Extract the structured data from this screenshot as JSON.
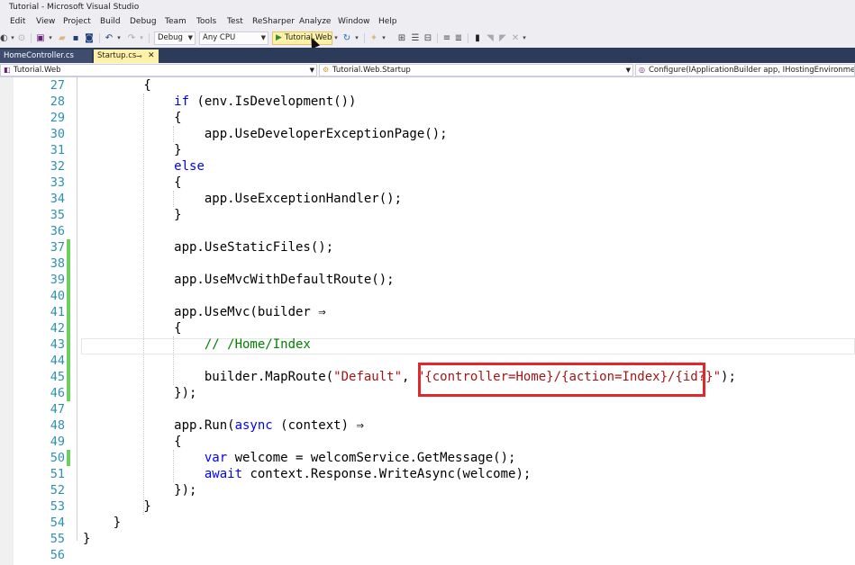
{
  "window": {
    "title": "Tutorial - Microsoft Visual Studio"
  },
  "menu": [
    "Edit",
    "View",
    "Project",
    "Build",
    "Debug",
    "Team",
    "Tools",
    "Test",
    "ReSharper",
    "Analyze",
    "Window",
    "Help"
  ],
  "toolbar": {
    "configuration": "Debug",
    "platform": "Any CPU",
    "run_target": "Tutorial.Web"
  },
  "tabs": [
    {
      "label": "HomeController.cs",
      "active": false
    },
    {
      "label": "Startup.cs",
      "active": true
    }
  ],
  "navbar": {
    "project": "Tutorial.Web",
    "type": "Tutorial.Web.Startup",
    "member": "Configure(IApplicationBuilder app, IHostingEnvironment env,"
  },
  "editor": {
    "lines": [
      {
        "num": "27",
        "changed": false,
        "parts": [
          {
            "t": "        {",
            "c": "p"
          }
        ]
      },
      {
        "num": "28",
        "changed": false,
        "parts": [
          {
            "t": "            ",
            "c": "p"
          },
          {
            "t": "if",
            "c": "kw"
          },
          {
            "t": " (env.IsDevelopment())",
            "c": "p"
          }
        ]
      },
      {
        "num": "29",
        "changed": false,
        "parts": [
          {
            "t": "            {",
            "c": "p"
          }
        ]
      },
      {
        "num": "30",
        "changed": false,
        "parts": [
          {
            "t": "                app.UseDeveloperExceptionPage();",
            "c": "p"
          }
        ]
      },
      {
        "num": "31",
        "changed": false,
        "parts": [
          {
            "t": "            }",
            "c": "p"
          }
        ]
      },
      {
        "num": "32",
        "changed": false,
        "parts": [
          {
            "t": "            ",
            "c": "p"
          },
          {
            "t": "else",
            "c": "kw"
          }
        ]
      },
      {
        "num": "33",
        "changed": false,
        "parts": [
          {
            "t": "            {",
            "c": "p"
          }
        ]
      },
      {
        "num": "34",
        "changed": false,
        "parts": [
          {
            "t": "                app.UseExceptionHandler();",
            "c": "p"
          }
        ]
      },
      {
        "num": "35",
        "changed": false,
        "parts": [
          {
            "t": "            }",
            "c": "p"
          }
        ]
      },
      {
        "num": "36",
        "changed": false,
        "parts": [
          {
            "t": "",
            "c": "p"
          }
        ]
      },
      {
        "num": "37",
        "changed": true,
        "parts": [
          {
            "t": "            app.UseStaticFiles();",
            "c": "p"
          }
        ]
      },
      {
        "num": "38",
        "changed": true,
        "parts": [
          {
            "t": "",
            "c": "p"
          }
        ]
      },
      {
        "num": "39",
        "changed": true,
        "parts": [
          {
            "t": "            app.UseMvcWithDefaultRoute();",
            "c": "p"
          }
        ]
      },
      {
        "num": "40",
        "changed": true,
        "parts": [
          {
            "t": "",
            "c": "p"
          }
        ]
      },
      {
        "num": "41",
        "changed": true,
        "parts": [
          {
            "t": "            app.UseMvc(builder ⇒",
            "c": "p"
          }
        ]
      },
      {
        "num": "42",
        "changed": true,
        "parts": [
          {
            "t": "            {",
            "c": "p"
          }
        ]
      },
      {
        "num": "43",
        "changed": true,
        "parts": [
          {
            "t": "                ",
            "c": "p"
          },
          {
            "t": "// /Home/Index",
            "c": "cmt"
          }
        ]
      },
      {
        "num": "44",
        "changed": true,
        "parts": [
          {
            "t": "",
            "c": "p"
          }
        ]
      },
      {
        "num": "45",
        "changed": true,
        "parts": [
          {
            "t": "                builder.MapRoute(",
            "c": "p"
          },
          {
            "t": "\"Default\"",
            "c": "str"
          },
          {
            "t": ", ",
            "c": "p"
          },
          {
            "t": "\"{controller=Home}/{action=Index}/{id?}\"",
            "c": "str"
          },
          {
            "t": ");",
            "c": "p"
          }
        ]
      },
      {
        "num": "46",
        "changed": true,
        "parts": [
          {
            "t": "            });",
            "c": "p"
          }
        ]
      },
      {
        "num": "47",
        "changed": false,
        "parts": [
          {
            "t": "",
            "c": "p"
          }
        ]
      },
      {
        "num": "48",
        "changed": false,
        "parts": [
          {
            "t": "            app.Run(",
            "c": "p"
          },
          {
            "t": "async",
            "c": "kw"
          },
          {
            "t": " (context) ⇒",
            "c": "p"
          }
        ]
      },
      {
        "num": "49",
        "changed": false,
        "parts": [
          {
            "t": "            {",
            "c": "p"
          }
        ]
      },
      {
        "num": "50",
        "changed": true,
        "parts": [
          {
            "t": "                ",
            "c": "p"
          },
          {
            "t": "var",
            "c": "kw"
          },
          {
            "t": " welcome = welcomService.GetMessage();",
            "c": "p"
          }
        ]
      },
      {
        "num": "51",
        "changed": false,
        "parts": [
          {
            "t": "                ",
            "c": "p"
          },
          {
            "t": "await",
            "c": "kw"
          },
          {
            "t": " context.Response.WriteAsync(welcome);",
            "c": "p"
          }
        ]
      },
      {
        "num": "52",
        "changed": false,
        "parts": [
          {
            "t": "            });",
            "c": "p"
          }
        ]
      },
      {
        "num": "53",
        "changed": false,
        "parts": [
          {
            "t": "        }",
            "c": "p"
          }
        ]
      },
      {
        "num": "54",
        "changed": false,
        "parts": [
          {
            "t": "    }",
            "c": "p"
          }
        ]
      },
      {
        "num": "55",
        "changed": false,
        "parts": [
          {
            "t": "}",
            "c": "p"
          }
        ]
      },
      {
        "num": "56",
        "changed": false,
        "parts": [
          {
            "t": "",
            "c": "p"
          }
        ]
      }
    ]
  },
  "colors": {
    "keyword": "#0000ff",
    "string": "#a31515",
    "comment": "#008000",
    "line_number": "#2b91af",
    "change_marker": "#6ccf5f",
    "highlight_box": "#e3262a",
    "tab_strip": "#2d3b5b",
    "active_tab": "#fff1a8"
  }
}
